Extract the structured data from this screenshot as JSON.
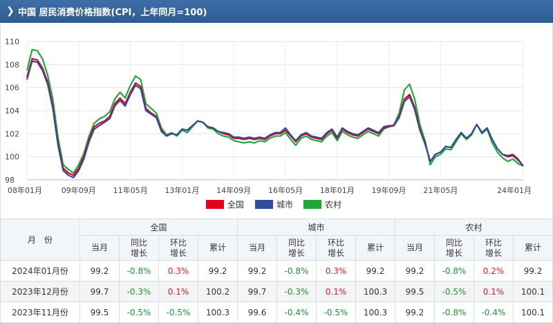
{
  "header": {
    "title": "中国 居民消费价格指数(CPI，上年同月=100)",
    "chevron_icon": "chevron-right-icon"
  },
  "chart_data": {
    "type": "line",
    "title": "",
    "ylim": [
      98,
      110
    ],
    "yticks": [
      98,
      100,
      102,
      104,
      106,
      108,
      110
    ],
    "x_tick_labels": [
      "08年01月",
      "09年09月",
      "11年05月",
      "13年01月",
      "14年09月",
      "16年05月",
      "18年01月",
      "19年09月",
      "21年05月",
      "24年01月"
    ],
    "x_tick_positions": [
      0,
      20,
      40,
      60,
      80,
      100,
      120,
      140,
      160,
      192
    ],
    "x_max": 192,
    "grid": true,
    "legend_position": "bottom-center",
    "series": [
      {
        "name": "全国",
        "color": "#e0001b",
        "points": [
          [
            0,
            106.9
          ],
          [
            2,
            108.5
          ],
          [
            4,
            108.4
          ],
          [
            6,
            107.7
          ],
          [
            8,
            106.5
          ],
          [
            10,
            104.4
          ],
          [
            12,
            101.2
          ],
          [
            14,
            99.0
          ],
          [
            16,
            98.6
          ],
          [
            18,
            98.4
          ],
          [
            20,
            99.0
          ],
          [
            22,
            100.0
          ],
          [
            24,
            101.5
          ],
          [
            26,
            102.6
          ],
          [
            28,
            102.9
          ],
          [
            30,
            103.1
          ],
          [
            32,
            103.5
          ],
          [
            34,
            104.6
          ],
          [
            36,
            105.1
          ],
          [
            38,
            104.6
          ],
          [
            40,
            105.6
          ],
          [
            42,
            106.4
          ],
          [
            44,
            106.1
          ],
          [
            46,
            104.2
          ],
          [
            48,
            103.8
          ],
          [
            50,
            103.5
          ],
          [
            52,
            102.3
          ],
          [
            54,
            101.8
          ],
          [
            56,
            102.0
          ],
          [
            58,
            101.9
          ],
          [
            60,
            102.4
          ],
          [
            62,
            102.3
          ],
          [
            64,
            102.7
          ],
          [
            66,
            103.1
          ],
          [
            68,
            103.0
          ],
          [
            70,
            102.6
          ],
          [
            72,
            102.5
          ],
          [
            74,
            102.2
          ],
          [
            76,
            102.0
          ],
          [
            78,
            101.9
          ],
          [
            80,
            101.6
          ],
          [
            82,
            101.6
          ],
          [
            84,
            101.5
          ],
          [
            86,
            101.6
          ],
          [
            88,
            101.5
          ],
          [
            90,
            101.6
          ],
          [
            92,
            101.5
          ],
          [
            94,
            101.8
          ],
          [
            96,
            102.0
          ],
          [
            98,
            102.0
          ],
          [
            100,
            102.3
          ],
          [
            102,
            101.8
          ],
          [
            104,
            101.3
          ],
          [
            106,
            101.8
          ],
          [
            108,
            102.0
          ],
          [
            110,
            101.7
          ],
          [
            112,
            101.6
          ],
          [
            114,
            101.5
          ],
          [
            116,
            102.0
          ],
          [
            118,
            102.3
          ],
          [
            120,
            101.6
          ],
          [
            122,
            102.4
          ],
          [
            124,
            102.1
          ],
          [
            126,
            101.9
          ],
          [
            128,
            101.8
          ],
          [
            130,
            102.1
          ],
          [
            132,
            102.4
          ],
          [
            134,
            102.2
          ],
          [
            136,
            102.0
          ],
          [
            138,
            102.5
          ],
          [
            140,
            102.6
          ],
          [
            142,
            102.7
          ],
          [
            144,
            103.5
          ],
          [
            146,
            105.0
          ],
          [
            148,
            105.4
          ],
          [
            150,
            104.3
          ],
          [
            152,
            102.4
          ],
          [
            154,
            101.2
          ],
          [
            156,
            99.6
          ],
          [
            158,
            100.2
          ],
          [
            160,
            100.4
          ],
          [
            162,
            100.9
          ],
          [
            164,
            100.8
          ],
          [
            166,
            101.5
          ],
          [
            168,
            102.1
          ],
          [
            170,
            101.6
          ],
          [
            172,
            102.0
          ],
          [
            174,
            102.8
          ],
          [
            176,
            102.1
          ],
          [
            178,
            102.5
          ],
          [
            180,
            101.5
          ],
          [
            182,
            100.7
          ],
          [
            184,
            100.2
          ],
          [
            186,
            100.0
          ],
          [
            188,
            100.1
          ],
          [
            190,
            99.7
          ],
          [
            192,
            99.2
          ]
        ]
      },
      {
        "name": "城市",
        "color": "#2e4e9a",
        "points": [
          [
            0,
            106.7
          ],
          [
            2,
            108.3
          ],
          [
            4,
            108.2
          ],
          [
            6,
            107.5
          ],
          [
            8,
            106.3
          ],
          [
            10,
            104.2
          ],
          [
            12,
            101.0
          ],
          [
            14,
            98.8
          ],
          [
            16,
            98.4
          ],
          [
            18,
            98.2
          ],
          [
            20,
            98.8
          ],
          [
            22,
            99.8
          ],
          [
            24,
            101.3
          ],
          [
            26,
            102.4
          ],
          [
            28,
            102.7
          ],
          [
            30,
            103.0
          ],
          [
            32,
            103.3
          ],
          [
            34,
            104.4
          ],
          [
            36,
            104.9
          ],
          [
            38,
            104.4
          ],
          [
            40,
            105.4
          ],
          [
            42,
            106.2
          ],
          [
            44,
            105.9
          ],
          [
            46,
            104.0
          ],
          [
            48,
            103.7
          ],
          [
            50,
            103.4
          ],
          [
            52,
            102.2
          ],
          [
            54,
            101.8
          ],
          [
            56,
            102.0
          ],
          [
            58,
            101.9
          ],
          [
            60,
            102.4
          ],
          [
            62,
            102.3
          ],
          [
            64,
            102.7
          ],
          [
            66,
            103.1
          ],
          [
            68,
            103.0
          ],
          [
            70,
            102.6
          ],
          [
            72,
            102.5
          ],
          [
            74,
            102.2
          ],
          [
            76,
            102.1
          ],
          [
            78,
            102.0
          ],
          [
            80,
            101.7
          ],
          [
            82,
            101.7
          ],
          [
            84,
            101.6
          ],
          [
            86,
            101.7
          ],
          [
            88,
            101.6
          ],
          [
            90,
            101.7
          ],
          [
            92,
            101.6
          ],
          [
            94,
            101.9
          ],
          [
            96,
            102.1
          ],
          [
            98,
            102.1
          ],
          [
            100,
            102.5
          ],
          [
            102,
            101.9
          ],
          [
            104,
            101.4
          ],
          [
            106,
            101.9
          ],
          [
            108,
            102.1
          ],
          [
            110,
            101.8
          ],
          [
            112,
            101.7
          ],
          [
            114,
            101.6
          ],
          [
            116,
            102.1
          ],
          [
            118,
            102.4
          ],
          [
            120,
            101.7
          ],
          [
            122,
            102.5
          ],
          [
            124,
            102.2
          ],
          [
            126,
            102.0
          ],
          [
            128,
            101.9
          ],
          [
            130,
            102.2
          ],
          [
            132,
            102.5
          ],
          [
            134,
            102.3
          ],
          [
            136,
            102.1
          ],
          [
            138,
            102.6
          ],
          [
            140,
            102.7
          ],
          [
            142,
            102.7
          ],
          [
            144,
            103.4
          ],
          [
            146,
            104.8
          ],
          [
            148,
            105.2
          ],
          [
            150,
            104.1
          ],
          [
            152,
            102.3
          ],
          [
            154,
            101.1
          ],
          [
            156,
            99.6
          ],
          [
            158,
            100.2
          ],
          [
            160,
            100.4
          ],
          [
            162,
            100.9
          ],
          [
            164,
            100.8
          ],
          [
            166,
            101.5
          ],
          [
            168,
            102.1
          ],
          [
            170,
            101.6
          ],
          [
            172,
            102.0
          ],
          [
            174,
            102.8
          ],
          [
            176,
            102.1
          ],
          [
            178,
            102.5
          ],
          [
            180,
            101.5
          ],
          [
            182,
            100.7
          ],
          [
            184,
            100.2
          ],
          [
            186,
            100.1
          ],
          [
            188,
            100.2
          ],
          [
            190,
            99.8
          ],
          [
            192,
            99.2
          ]
        ]
      },
      {
        "name": "农村",
        "color": "#22a83a",
        "points": [
          [
            0,
            107.5
          ],
          [
            2,
            109.3
          ],
          [
            4,
            109.2
          ],
          [
            6,
            108.5
          ],
          [
            8,
            107.1
          ],
          [
            10,
            105.0
          ],
          [
            12,
            101.7
          ],
          [
            14,
            99.3
          ],
          [
            16,
            98.9
          ],
          [
            18,
            98.6
          ],
          [
            20,
            99.3
          ],
          [
            22,
            100.3
          ],
          [
            24,
            101.8
          ],
          [
            26,
            102.9
          ],
          [
            28,
            103.3
          ],
          [
            30,
            103.5
          ],
          [
            32,
            103.9
          ],
          [
            34,
            105.0
          ],
          [
            36,
            105.6
          ],
          [
            38,
            105.1
          ],
          [
            40,
            106.2
          ],
          [
            42,
            107.0
          ],
          [
            44,
            106.7
          ],
          [
            46,
            104.6
          ],
          [
            48,
            104.2
          ],
          [
            50,
            103.8
          ],
          [
            52,
            102.5
          ],
          [
            54,
            101.9
          ],
          [
            56,
            102.1
          ],
          [
            58,
            101.8
          ],
          [
            60,
            102.3
          ],
          [
            62,
            102.1
          ],
          [
            64,
            102.6
          ],
          [
            66,
            103.1
          ],
          [
            68,
            103.0
          ],
          [
            70,
            102.5
          ],
          [
            72,
            102.4
          ],
          [
            74,
            102.0
          ],
          [
            76,
            101.8
          ],
          [
            78,
            101.7
          ],
          [
            80,
            101.4
          ],
          [
            82,
            101.3
          ],
          [
            84,
            101.2
          ],
          [
            86,
            101.3
          ],
          [
            88,
            101.2
          ],
          [
            90,
            101.4
          ],
          [
            92,
            101.3
          ],
          [
            94,
            101.6
          ],
          [
            96,
            101.8
          ],
          [
            98,
            101.8
          ],
          [
            100,
            102.1
          ],
          [
            102,
            101.5
          ],
          [
            104,
            101.0
          ],
          [
            106,
            101.6
          ],
          [
            108,
            101.8
          ],
          [
            110,
            101.5
          ],
          [
            112,
            101.4
          ],
          [
            114,
            101.3
          ],
          [
            116,
            101.8
          ],
          [
            118,
            102.1
          ],
          [
            120,
            101.4
          ],
          [
            122,
            102.2
          ],
          [
            124,
            101.9
          ],
          [
            126,
            101.7
          ],
          [
            128,
            101.6
          ],
          [
            130,
            101.9
          ],
          [
            132,
            102.2
          ],
          [
            134,
            102.0
          ],
          [
            136,
            101.8
          ],
          [
            138,
            102.4
          ],
          [
            140,
            102.6
          ],
          [
            142,
            102.8
          ],
          [
            144,
            103.8
          ],
          [
            146,
            105.8
          ],
          [
            148,
            106.3
          ],
          [
            150,
            105.0
          ],
          [
            152,
            102.8
          ],
          [
            154,
            101.4
          ],
          [
            156,
            99.3
          ],
          [
            158,
            100.0
          ],
          [
            160,
            100.2
          ],
          [
            162,
            100.7
          ],
          [
            164,
            100.6
          ],
          [
            166,
            101.3
          ],
          [
            168,
            102.0
          ],
          [
            170,
            101.5
          ],
          [
            172,
            101.9
          ],
          [
            174,
            102.8
          ],
          [
            176,
            102.0
          ],
          [
            178,
            102.4
          ],
          [
            180,
            101.2
          ],
          [
            182,
            100.4
          ],
          [
            184,
            99.9
          ],
          [
            186,
            99.6
          ],
          [
            188,
            99.8
          ],
          [
            190,
            99.4
          ],
          [
            192,
            99.2
          ]
        ]
      }
    ]
  },
  "table": {
    "month_header": "月　份",
    "groups": [
      "全国",
      "城市",
      "农村"
    ],
    "sub_headers": [
      "当月",
      "同比\n增长",
      "环比\n增长",
      "累计"
    ],
    "rows": [
      {
        "month": "2024年01月份",
        "cells": [
          [
            "99.2",
            "-0.8%",
            "0.3%",
            "99.2"
          ],
          [
            "99.2",
            "-0.8%",
            "0.3%",
            "99.2"
          ],
          [
            "99.2",
            "-0.8%",
            "0.2%",
            "99.2"
          ]
        ]
      },
      {
        "month": "2023年12月份",
        "cells": [
          [
            "99.7",
            "-0.3%",
            "0.1%",
            "100.2"
          ],
          [
            "99.7",
            "-0.3%",
            "0.1%",
            "100.3"
          ],
          [
            "99.5",
            "-0.5%",
            "0.1%",
            "100.1"
          ]
        ]
      },
      {
        "month": "2023年11月份",
        "cells": [
          [
            "99.5",
            "-0.5%",
            "-0.5%",
            "100.3"
          ],
          [
            "99.6",
            "-0.4%",
            "-0.5%",
            "100.3"
          ],
          [
            "99.2",
            "-0.8%",
            "-0.4%",
            "100.1"
          ]
        ]
      }
    ]
  },
  "colors": {
    "header_bg": "#2d5b93",
    "positive": "#e31b23",
    "negative": "#21913a"
  }
}
